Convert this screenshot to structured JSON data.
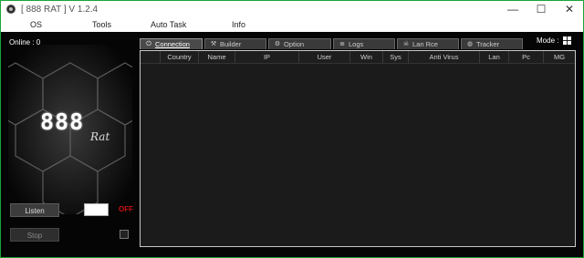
{
  "window": {
    "title": "[ 888 RAT ] V 1.2.4",
    "minimize": "—",
    "maximize": "☐",
    "close": "✕"
  },
  "menu": {
    "items": [
      "OS",
      "Tools",
      "Auto Task",
      "Info"
    ]
  },
  "sidebar": {
    "online_label": "Online : 0",
    "logo_main": "888",
    "logo_sub": "Rat",
    "listen_label": "Listen",
    "stop_label": "Stop",
    "port_value": "",
    "status": "OFF",
    "status_color": "#cc1111"
  },
  "mode_label": "Mode :",
  "tabs": [
    {
      "label": "Connection",
      "icon": "plug-icon",
      "glyph": "⏻",
      "active": true
    },
    {
      "label": "Builder",
      "icon": "tools-icon",
      "glyph": "⚒",
      "active": false
    },
    {
      "label": "Option",
      "icon": "gear-icon",
      "glyph": "⚙",
      "active": false
    },
    {
      "label": "Logs",
      "icon": "file-icon",
      "glyph": "≣",
      "active": false
    },
    {
      "label": "Lan Rce",
      "icon": "skull-icon",
      "glyph": "☠",
      "active": false
    },
    {
      "label": "Tracker",
      "icon": "globe-icon",
      "glyph": "◍",
      "active": false
    }
  ],
  "table": {
    "columns": [
      "",
      "Country",
      "Name",
      "IP",
      "User",
      "Win",
      "Sys",
      "Anti Virus",
      "Lan",
      "Pc",
      "MG"
    ],
    "rows": []
  },
  "colors": {
    "window_border": "#1aa33a",
    "background": "#050505",
    "accent_off": "#cc1111"
  }
}
